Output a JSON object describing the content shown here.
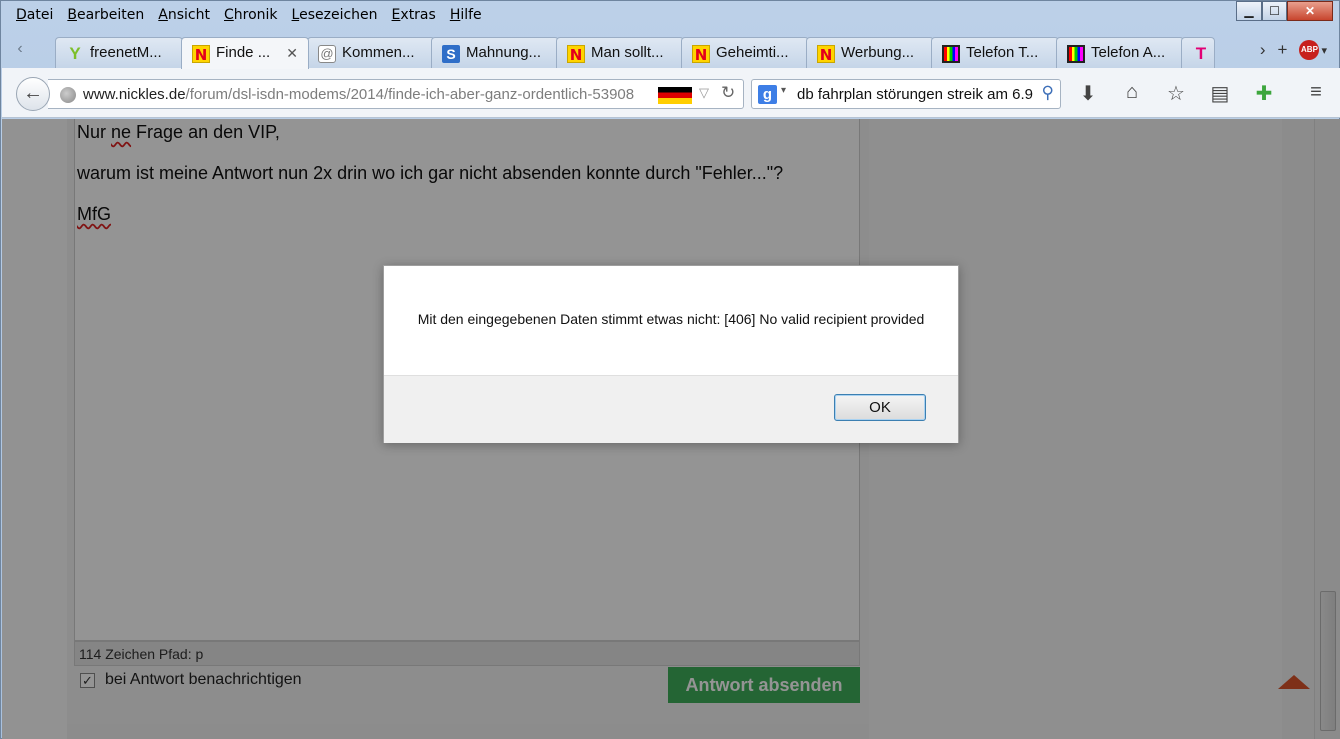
{
  "menubar": {
    "items": [
      {
        "u": "D",
        "rest": "atei"
      },
      {
        "u": "B",
        "rest": "earbeiten"
      },
      {
        "u": "A",
        "rest": "nsicht"
      },
      {
        "u": "C",
        "rest": "hronik"
      },
      {
        "u": "L",
        "rest": "esezeichen"
      },
      {
        "u": "E",
        "rest": "xtras"
      },
      {
        "u": "H",
        "rest": "ilfe"
      }
    ]
  },
  "window_controls": {
    "minimize": "▁",
    "maximize": "☐",
    "close": "✕"
  },
  "tabs": [
    {
      "label": "freenetM...",
      "icon": "leaf-icon"
    },
    {
      "label": "Finde ...",
      "icon": "nickles-n-icon",
      "active": true
    },
    {
      "label": "Kommen...",
      "icon": "at-icon"
    },
    {
      "label": "Mahnung...",
      "icon": "s-icon"
    },
    {
      "label": "Man sollt...",
      "icon": "nickles-n-icon"
    },
    {
      "label": "Geheimti...",
      "icon": "nickles-n-icon"
    },
    {
      "label": "Werbung...",
      "icon": "nickles-n-icon"
    },
    {
      "label": "Telefon T...",
      "icon": "tv-icon"
    },
    {
      "label": "Telefon A...",
      "icon": "tv-icon"
    }
  ],
  "tab_glyphs": {
    "n": "N",
    "s": "S",
    "at": "@",
    "leaf": "Y",
    "t": "T",
    "close": "✕",
    "scroll_left": "‹",
    "scroll_right": "›",
    "new_tab": "+",
    "abp": "ABP",
    "abp_drop": "▾"
  },
  "urlbar": {
    "host": "www.nickles.de",
    "path": "/forum/dsl-isdn-modems/2014/finde-ich-aber-ganz-ordentlich-53908",
    "dropdown": "▽",
    "reload": "↻"
  },
  "searchbar": {
    "engine_glyph": "g",
    "drop": "▾",
    "query": "db fahrplan störungen streik am 6.9",
    "magnifier": "⚲"
  },
  "toolbar": {
    "back": "←",
    "download": "⬇",
    "home": "⌂",
    "bookmark": "☆",
    "reader": "▤",
    "addon": "✚",
    "menu": "≡"
  },
  "editor": {
    "line1_pre": "Nur ",
    "line1_err": "ne",
    "line1_post": " Frage an den VIP,",
    "line2": "warum ist meine Antwort nun 2x drin wo ich gar nicht absenden konnte durch \"Fehler...\"?",
    "line3": "MfG"
  },
  "status_line": "114 Zeichen Pfad: p",
  "notify": {
    "check": "✓",
    "label": "bei Antwort benachrichtigen"
  },
  "submit_label": "Antwort absenden",
  "dialog": {
    "message": "Mit den eingegebenen Daten stimmt etwas nicht: [406] No valid recipient provided",
    "ok_label": "OK"
  }
}
